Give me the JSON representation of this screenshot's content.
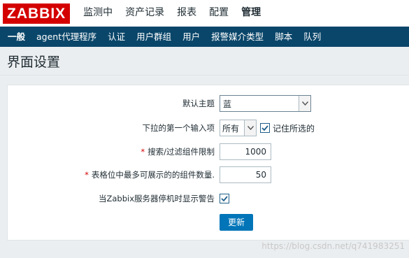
{
  "logo": "ZABBIX",
  "top_nav": [
    {
      "label": "监测中",
      "active": false
    },
    {
      "label": "资产记录",
      "active": false
    },
    {
      "label": "报表",
      "active": false
    },
    {
      "label": "配置",
      "active": false
    },
    {
      "label": "管理",
      "active": true
    }
  ],
  "sub_nav": [
    {
      "label": "一般",
      "active": true
    },
    {
      "label": "agent代理程序",
      "active": false
    },
    {
      "label": "认证",
      "active": false
    },
    {
      "label": "用户群组",
      "active": false
    },
    {
      "label": "用户",
      "active": false
    },
    {
      "label": "报警媒介类型",
      "active": false
    },
    {
      "label": "脚本",
      "active": false
    },
    {
      "label": "队列",
      "active": false
    }
  ],
  "page_title": "界面设置",
  "form": {
    "theme_label": "默认主题",
    "theme_value": "蓝",
    "dropdown_first_label": "下拉的第一个输入项",
    "dropdown_first_value": "所有",
    "remember_label": "记住所选的",
    "remember_checked": true,
    "search_limit_label": "搜索/过滤组件限制",
    "search_limit_value": "1000",
    "max_table_label": "表格位中最多可展示的的组件数量.",
    "max_table_value": "50",
    "server_warning_label": "当Zabbix服务器停机时显示警告",
    "server_warning_checked": true,
    "required_marker": "*",
    "submit_label": "更新"
  },
  "watermark": "https://blog.csdn.net/q741983251",
  "colors": {
    "logo_bg": "#d40000",
    "subnav_bg": "#0a466a",
    "button_bg": "#0275b8",
    "page_bg": "#ebeef0"
  }
}
